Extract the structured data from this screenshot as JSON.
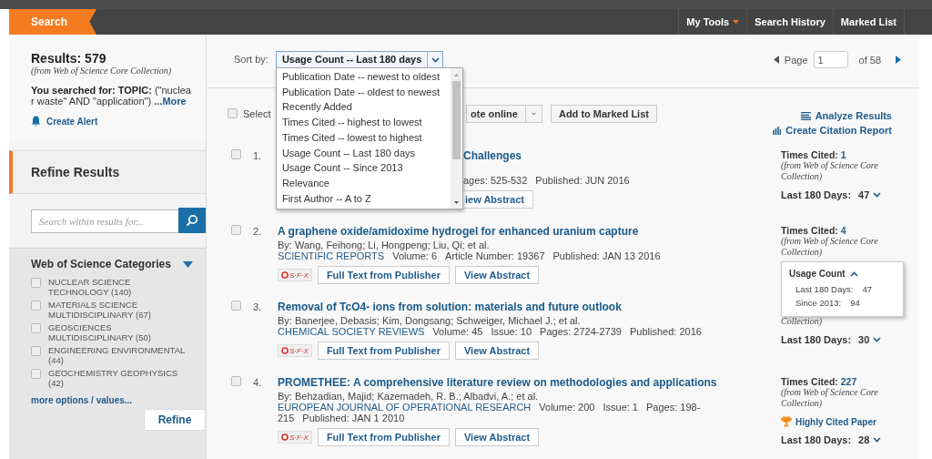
{
  "nav": {
    "search_tab": "Search",
    "items": [
      {
        "label": "My Tools",
        "kind": "menu"
      },
      {
        "label": "Search History",
        "kind": "link"
      },
      {
        "label": "Marked List",
        "kind": "link"
      }
    ]
  },
  "sidebar": {
    "results_title": "Results: 579",
    "results_note": "(from Web of Science Core Collection)",
    "searched": "**You searched for: TOPIC:** (\"nuclear waste\" AND \"application\")",
    "more_link": "...More",
    "create_alert": "Create Alert",
    "refine_title": "Refine Results",
    "search_placeholder": "Search within results for...",
    "categories": {
      "title": "Web of Science Categories",
      "expanded": true,
      "items": [
        {
          "label": "NUCLEAR SCIENCE TECHNOLOGY (140)",
          "checked": false
        },
        {
          "label": "MATERIALS SCIENCE MULTIDISCIPLINARY (67)",
          "checked": false
        },
        {
          "label": "GEOSCIENCES MULTIDISCIPLINARY (50)",
          "checked": false
        },
        {
          "label": "ENGINEERING ENVIRONMENTAL (44)",
          "checked": false
        },
        {
          "label": "GEOCHEMISTRY GEOPHYSICS (42)",
          "checked": false
        }
      ],
      "more": "more options / values...",
      "refine": "Refine"
    }
  },
  "main": {
    "sort_label": "Sort by:",
    "sort_value": "Usage Count -- Last 180 days",
    "sort_options": [
      "Publication Date -- newest to oldest",
      "Publication Date -- oldest to newest",
      "Recently Added",
      "Times Cited -- highest to lowest",
      "Times Cited -- lowest to highest",
      "Usage Count -- Last 180 days",
      "Usage Count -- Since 2013",
      "Relevance",
      "First Author -- A to Z"
    ],
    "pager": {
      "label": "Page",
      "value": "1",
      "of": "of 58"
    },
    "toolbar": {
      "select_label": "Select",
      "select_checked": false,
      "export_label": "ote online",
      "add_label": "Add to Marked List"
    },
    "links": [
      {
        "kind": "analyze",
        "label": "Analyze Results"
      },
      {
        "kind": "citation",
        "label": "Create Citation Report"
      }
    ],
    "records": [
      {
        "kind": "covered",
        "number": "1.",
        "checked": false,
        "title": "Challenges",
        "details": [
          "ages: 525-532",
          "Published: JUN 2016"
        ],
        "buttons": [
          {
            "kind": "abstract",
            "label": "iew Abstract"
          }
        ],
        "times_cited_label": "Times Cited:",
        "times_cited": "1",
        "source_note": "(from Web of Science Core Collection)",
        "usage_label": "Last 180 Days:",
        "usage": "47"
      },
      {
        "kind": "full",
        "number": "2.",
        "checked": false,
        "title": "A graphene oxide/amidoxime hydrogel for enhanced uranium capture",
        "byline": "By: Wang, Feihong; Li, Hongpeng; Liu, Qi; et al.",
        "journal": "SCIENTIFIC REPORTS",
        "details": [
          "Volume: 6",
          "Article Number: 19367",
          "Published: JAN 13 2016"
        ],
        "buttons": [
          {
            "kind": "sfx",
            "label": "S·F·X"
          },
          {
            "kind": "fulltext",
            "label": "Full Text from Publisher"
          },
          {
            "kind": "abstract",
            "label": "View Abstract"
          }
        ],
        "times_cited_label": "Times Cited:",
        "times_cited": "4",
        "source_note": "(from Web of Science Core Collection)",
        "popup": {
          "title": "Usage Count",
          "expanded": true,
          "rows": [
            {
              "label": "Last 180 Days:",
              "value": "47"
            },
            {
              "label": "Since 2013:",
              "value": "94"
            }
          ]
        }
      },
      {
        "kind": "full",
        "number": "3.",
        "checked": false,
        "title": "Removal of TcO4- ions from solution: materials and future outlook",
        "byline": "By: Banerjee, Debasis; Kim, Dongsang; Schweiger, Michael J.; et al.",
        "journal": "CHEMICAL SOCIETY REVIEWS",
        "details": [
          "Volume: 45",
          "Issue: 10",
          "Pages: 2724-2739",
          "Published: 2016"
        ],
        "buttons": [
          {
            "kind": "sfx",
            "label": "S·F·X"
          },
          {
            "kind": "fulltext",
            "label": "Full Text from Publisher"
          },
          {
            "kind": "abstract",
            "label": "View Abstract"
          }
        ],
        "source_note": "Collection)",
        "usage_label": "Last 180 Days:",
        "usage": "30"
      },
      {
        "kind": "full",
        "number": "4.",
        "checked": false,
        "title": "PROMETHEE: A comprehensive literature review on methodologies and applications",
        "byline": "By: Behzadian, Majid; Kazemadeh, R. B.; Albadvi, A.; et al.",
        "journal": "EUROPEAN JOURNAL OF OPERATIONAL RESEARCH",
        "details": [
          "Volume: 200",
          "Issue: 1",
          "Pages: 198-215",
          "Published: JAN 1 2010"
        ],
        "buttons": [
          {
            "kind": "sfx",
            "label": "S·F·X"
          },
          {
            "kind": "fulltext",
            "label": "Full Text from Publisher"
          },
          {
            "kind": "abstract",
            "label": "View Abstract"
          }
        ],
        "times_cited_label": "Times Cited:",
        "times_cited": "227",
        "source_note": "(from Web of Science Core Collection)",
        "highly_cited": "Highly Cited Paper",
        "usage_label": "Last 180 Days:",
        "usage": "28"
      }
    ]
  }
}
